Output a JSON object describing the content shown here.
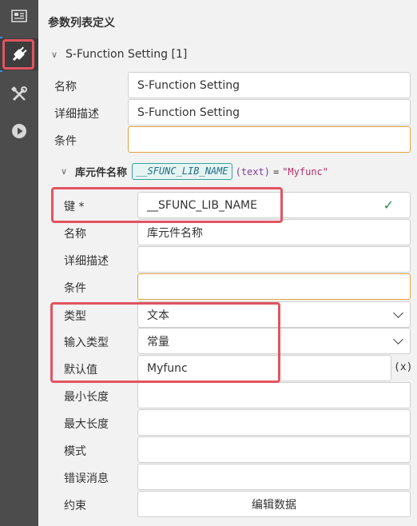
{
  "sidebar": {
    "icons": [
      {
        "name": "layout-icon"
      },
      {
        "name": "plug-icon"
      },
      {
        "name": "tools-icon"
      },
      {
        "name": "play-icon"
      }
    ]
  },
  "main": {
    "title": "参数列表定义",
    "section": {
      "title": "S-Function Setting [1]",
      "fields": [
        {
          "label": "名称",
          "value": "S-Function Setting"
        },
        {
          "label": "详细描述",
          "value": "S-Function Setting"
        },
        {
          "label": "条件",
          "value": ""
        }
      ]
    },
    "subsection": {
      "name": "库元件名称",
      "key": "__SFUNC_LIB_NAME",
      "type": "(text)",
      "equals": "=",
      "value": "\"Myfunc\"",
      "fields": {
        "key_label": "键 *",
        "key_value": "__SFUNC_LIB_NAME",
        "name_label": "名称",
        "name_value": "库元件名称",
        "desc_label": "详细描述",
        "desc_value": "",
        "cond_label": "条件",
        "cond_value": "",
        "type_label": "类型",
        "type_value": "文本",
        "input_type_label": "输入类型",
        "input_type_value": "常量",
        "default_label": "默认值",
        "default_value": "Myfunc",
        "expr_button": "(x)",
        "min_len_label": "最小长度",
        "min_len_value": "",
        "max_len_label": "最大长度",
        "max_len_value": "",
        "pattern_label": "模式",
        "pattern_value": "",
        "error_label": "错误消息",
        "error_value": "",
        "constraint_label": "约束",
        "edit_data_button": "编辑数据"
      }
    }
  },
  "colors": {
    "highlight": "#e25461",
    "focus_border": "#e0a340",
    "valid_check": "#2e8b57"
  }
}
